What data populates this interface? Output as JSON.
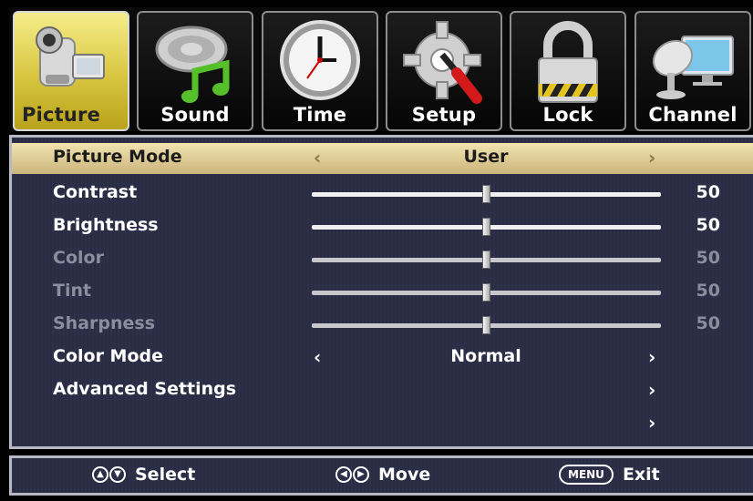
{
  "tabs": [
    {
      "label": "Picture",
      "icon": "camcorder-icon",
      "active": true
    },
    {
      "label": "Sound",
      "icon": "speaker-music-icon",
      "active": false
    },
    {
      "label": "Time",
      "icon": "clock-icon",
      "active": false
    },
    {
      "label": "Setup",
      "icon": "gear-screwdriver-icon",
      "active": false
    },
    {
      "label": "Lock",
      "icon": "padlock-icon",
      "active": false
    },
    {
      "label": "Channel",
      "icon": "satellite-monitor-icon",
      "active": false
    }
  ],
  "menu": {
    "picture_mode": {
      "label": "Picture Mode",
      "value": "User"
    },
    "contrast": {
      "label": "Contrast",
      "value": "50",
      "level": 0.5
    },
    "brightness": {
      "label": "Brightness",
      "value": "50",
      "level": 0.5
    },
    "color": {
      "label": "Color",
      "value": "50",
      "level": 0.5
    },
    "tint": {
      "label": "Tint",
      "value": "50",
      "level": 0.5
    },
    "sharpness": {
      "label": "Sharpness",
      "value": "50",
      "level": 0.5
    },
    "color_mode": {
      "label": "Color Mode",
      "value": "Normal"
    },
    "advanced": {
      "label": "Advanced Settings"
    }
  },
  "footer": {
    "select": "Select",
    "move": "Move",
    "menu_key": "MENU",
    "exit": "Exit"
  },
  "colors": {
    "active_tab": "#d8c640",
    "highlight_row": "#e6d39a",
    "panel_bg": "#2b2e46",
    "dim_text": "#8a8d9c"
  }
}
